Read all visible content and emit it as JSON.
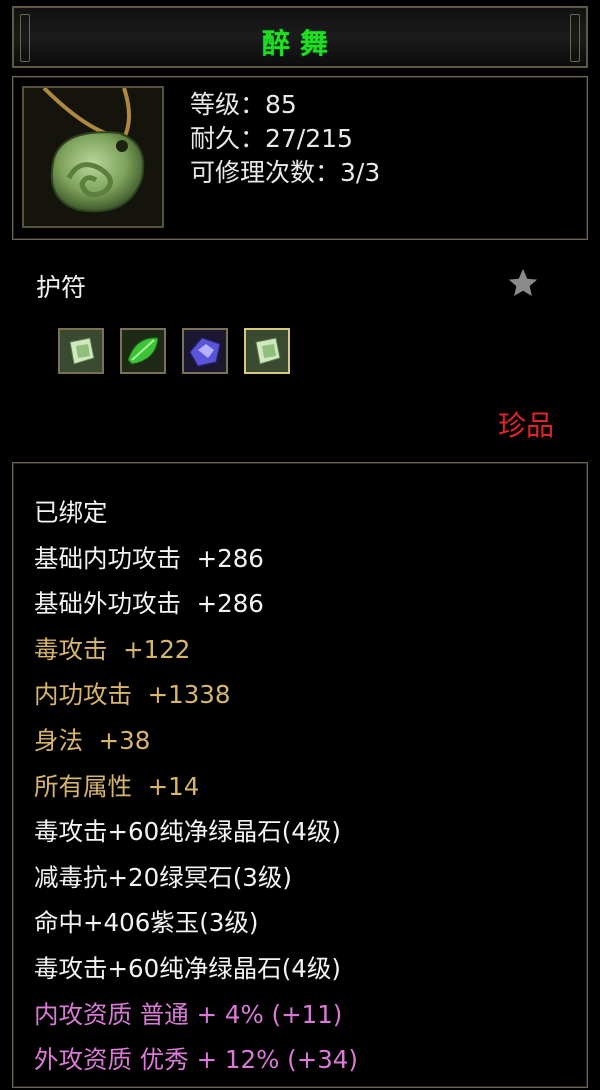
{
  "item": {
    "name": "醉舞",
    "level_label": "等级：85",
    "durability_label": "耐久：27/215",
    "repair_label": "可修理次数：3/3",
    "type": "护符",
    "rarity": "珍品"
  },
  "gems": [
    "green-crystal-gem-icon",
    "green-leaf-gem-icon",
    "purple-jade-gem-icon",
    "green-crystal-gem-icon"
  ],
  "attributes": [
    {
      "text": "已绑定",
      "color": "white"
    },
    {
      "text": "基础内功攻击  +286",
      "color": "white"
    },
    {
      "text": "基础外功攻击  +286",
      "color": "white"
    },
    {
      "text": "毒攻击  +122",
      "color": "gold"
    },
    {
      "text": "内功攻击  +1338",
      "color": "gold"
    },
    {
      "text": "身法  +38",
      "color": "gold"
    },
    {
      "text": "所有属性  +14",
      "color": "gold"
    },
    {
      "text": "毒攻击+60纯净绿晶石(4级)",
      "color": "white"
    },
    {
      "text": "减毒抗+20绿冥石(3级)",
      "color": "white"
    },
    {
      "text": "命中+406紫玉(3级)",
      "color": "white"
    },
    {
      "text": "毒攻击+60纯净绿晶石(4级)",
      "color": "white"
    },
    {
      "text": "内攻资质 普通 + 4% (+11)",
      "color": "pink"
    },
    {
      "text": "外攻资质 优秀 + 12% (+34)",
      "color": "pink"
    }
  ],
  "colors": {
    "title": "#1fe01f",
    "rarity": "#e0242a",
    "white": "#f3f3f3",
    "gold": "#d7b56b",
    "pink": "#d97bd6"
  }
}
